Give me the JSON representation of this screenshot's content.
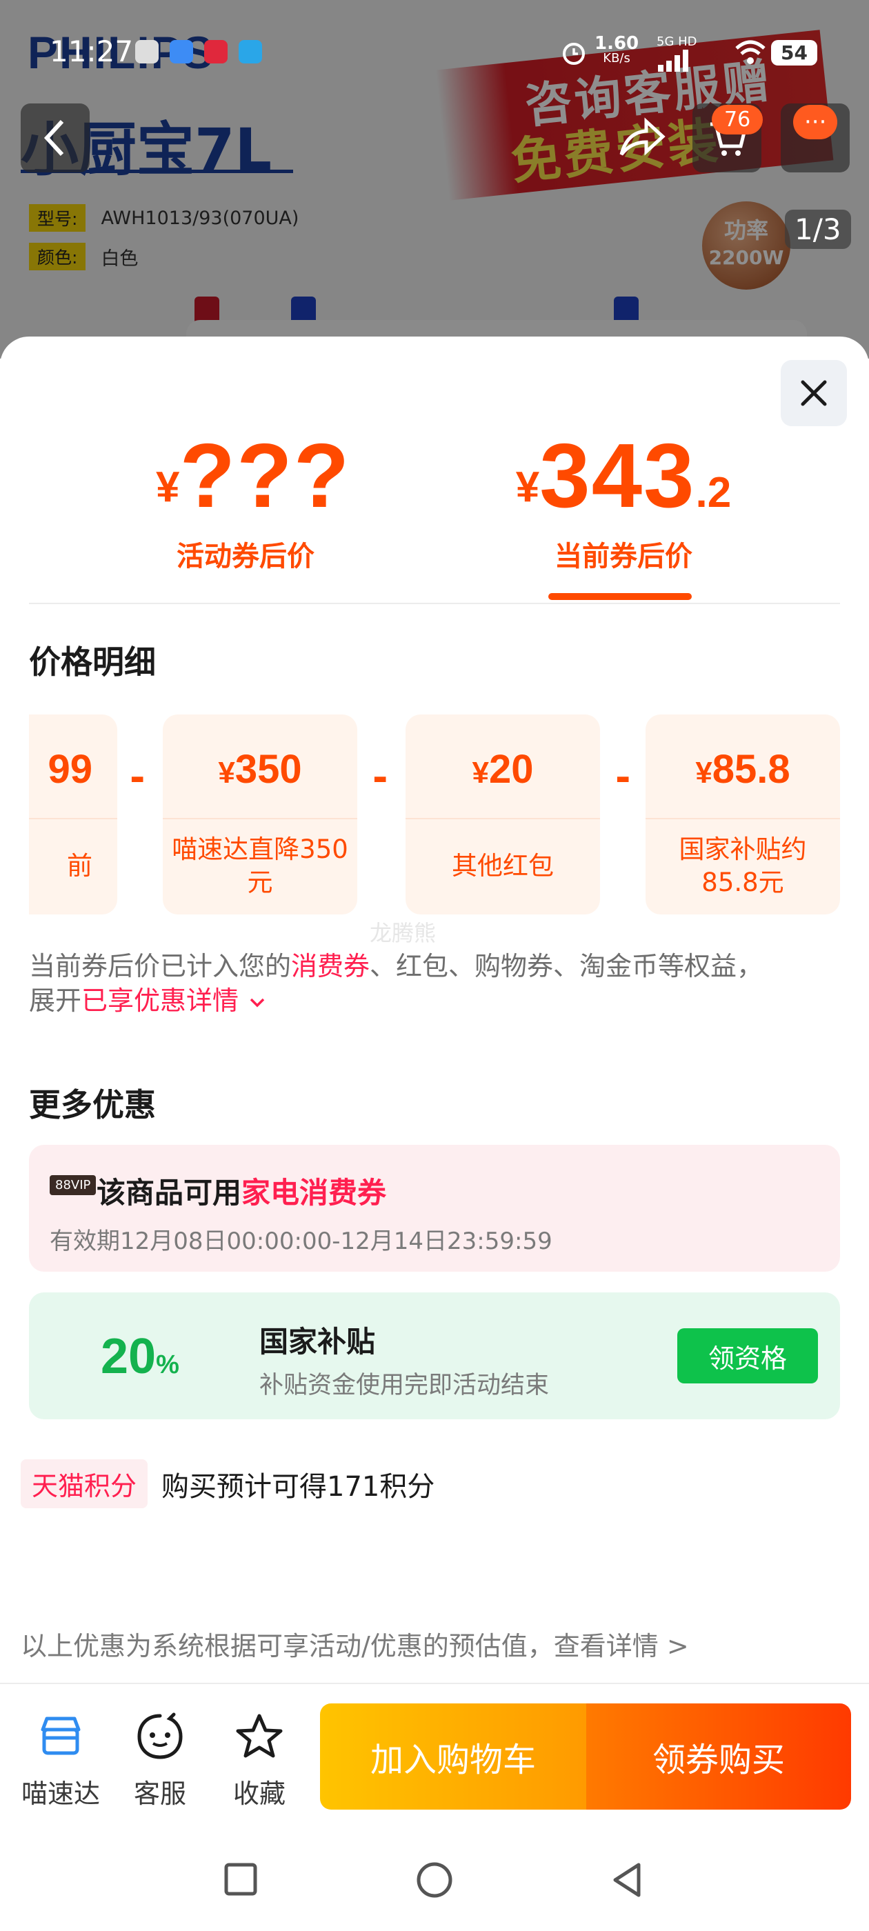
{
  "status_bar": {
    "time": "11:27",
    "net_speed": "1.60",
    "net_unit": "KB/s",
    "network": "5G HD",
    "battery": "54"
  },
  "background_product": {
    "brand": "PHILIPS",
    "product_name": "小厨宝7L",
    "spec_model_label": "型号:",
    "spec_model_value": "AWH1013/93(070UA)",
    "spec_color_label": "颜色:",
    "spec_color_value": "白色",
    "promo_line1": "咨询客服赠",
    "promo_line2": "免费安装",
    "power_badge_line1": "功率",
    "power_badge_line2": "2200W",
    "image_counter": "1/3",
    "cart_count": "76",
    "more_badge": "···"
  },
  "price_header": {
    "activity_price_symbol": "¥",
    "activity_price": "???",
    "activity_label": "活动券后价",
    "current_price_symbol": "¥",
    "current_price_int": "343",
    "current_price_dec": ".2",
    "current_label": "当前券后价"
  },
  "price_detail": {
    "title": "价格明细",
    "cards": [
      {
        "amount": "99",
        "desc": "前"
      },
      {
        "symbol": "¥",
        "amount": "350",
        "desc": "喵速达直降350元"
      },
      {
        "symbol": "¥",
        "amount": "20",
        "desc": "其他红包"
      },
      {
        "symbol": "¥",
        "amount": "85.8",
        "desc": "国家补贴约85.8元"
      }
    ],
    "minus": "-"
  },
  "watermark": "龙腾熊",
  "note": {
    "part1": "当前券后价已计入您的",
    "hl1": "消费券",
    "part2": "、红包、购物券、淘金币等权益，",
    "part3": "展开",
    "hl2": "已享优惠详情"
  },
  "more_offers": {
    "title": "更多优惠",
    "coupon": {
      "badge": "88VIP",
      "title_prefix": "该商品可用",
      "title_highlight": "家电消费券",
      "validity": "有效期12月08日00:00:00-12月14日23:59:59"
    },
    "subsidy": {
      "percent": "20",
      "percent_sign": "%",
      "title": "国家补贴",
      "subtitle": "补贴资金使用完即活动结束",
      "button": "领资格"
    },
    "points": {
      "tag": "天猫积分",
      "text": "购买预计可得171积分"
    }
  },
  "disclaimer": "以上优惠为系统根据可享活动/优惠的预估值，查看详情 >",
  "actions": {
    "store": "喵速达",
    "service": "客服",
    "favorite": "收藏",
    "add_cart": "加入购物车",
    "buy": "领券购买"
  },
  "colors": {
    "accent_orange": "#ff4a00",
    "highlight_pink": "#ff1f4f",
    "subsidy_green": "#0ec24b"
  }
}
